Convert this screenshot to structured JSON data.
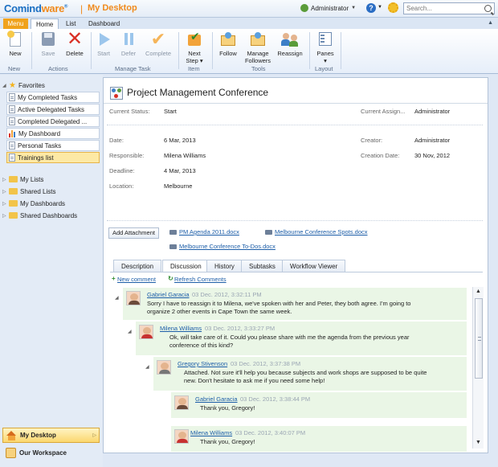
{
  "header": {
    "logo_main": "Comind",
    "logo_accent": "ware",
    "logo_tm": "®",
    "separator": "|",
    "page_title": "My Desktop",
    "user_name": "Administrator",
    "caret": "▼",
    "help_glyph": "?",
    "search_placeholder": "Search..."
  },
  "tabs": {
    "menu": "Menu",
    "home": "Home",
    "list": "List",
    "dashboard": "Dashboard",
    "collapse": "▲"
  },
  "ribbon": {
    "new": "New",
    "save": "Save",
    "delete": "Delete",
    "start": "Start",
    "defer": "Defer",
    "complete": "Complete",
    "next_step_line1": "Next",
    "next_step_line2": "Step ▾",
    "follow": "Follow",
    "manage_followers_line1": "Manage",
    "manage_followers_line2": "Followers",
    "reassign": "Reassign",
    "panes": "Panes",
    "panes_caret": "▾",
    "groups": {
      "new": "New",
      "actions": "Actions",
      "manage_task": "Manage Task",
      "item": "Item",
      "tools": "Tools",
      "layout": "Layout"
    }
  },
  "sidebar": {
    "favorites": "Favorites",
    "items": [
      {
        "label": "My Completed Tasks"
      },
      {
        "label": "Active Delegated Tasks"
      },
      {
        "label": "Completed Delegated ..."
      },
      {
        "label": "My Dashboard"
      },
      {
        "label": "Personal Tasks"
      },
      {
        "label": "Trainings list"
      }
    ],
    "groups": [
      {
        "label": "My Lists"
      },
      {
        "label": "Shared Lists"
      },
      {
        "label": "My Dashboards"
      },
      {
        "label": "Shared Dashboards"
      }
    ],
    "my_desktop": "My Desktop",
    "our_workspace": "Our Workspace"
  },
  "task": {
    "title": "Project Management Conference",
    "fields": {
      "current_status_label": "Current Status:",
      "current_status": "Start",
      "current_assignee_label": "Current Assign...",
      "current_assignee": "Administrator",
      "date_label": "Date:",
      "date": "6 Mar, 2013",
      "creator_label": "Creator:",
      "creator": "Administrator",
      "responsible_label": "Responsible:",
      "responsible": "Milena Williams",
      "creation_date_label": "Creation Date:",
      "creation_date": "30 Nov, 2012",
      "deadline_label": "Deadline:",
      "deadline": "4 Mar, 2013",
      "location_label": "Location:",
      "location": "Melbourne"
    },
    "add_attachment": "Add Attachment",
    "attachments": [
      "PM Agenda 2011.docx",
      "Melbourne Conference Spots.docx",
      "Melbourne Conference To-Dos.docx"
    ]
  },
  "detail_tabs": [
    "Description",
    "Discussion",
    "History",
    "Subtasks",
    "Workflow Viewer"
  ],
  "actions": {
    "new_comment_glyph": "+",
    "new_comment": "New comment",
    "refresh_glyph": "↻",
    "refresh": "Refresh Comments"
  },
  "comments": [
    {
      "author": "Gabriel Garacia",
      "stamp": "03 Dec. 2012, 3:32:11 PM",
      "line1": "Sorry I have to reassign it to Milena, we've spoken with her and Peter, they both agree. I'm going to",
      "line2": "organize 2 other events in Cape Town the same week."
    },
    {
      "author": "Milena Williams",
      "stamp": "03 Dec. 2012, 3:33:27 PM",
      "line1": "Ok, will take care of it. Could you please share with me the agenda from the previous year",
      "line2": "conference of this kind?"
    },
    {
      "author": "Gregory Stivenson",
      "stamp": "03 Dec. 2012, 3:37:38 PM",
      "line1": "Attached. Not sure it'll help you because subjects and work shops are supposed to be quite",
      "line2": "new. Don't hesitate to ask me if you need some help!"
    },
    {
      "author": "Gabriel Garacia",
      "stamp": "03 Dec. 2012, 3:38:44 PM",
      "line1": "Thank you, Gregory!",
      "line2": ""
    },
    {
      "author": "Milena Williams",
      "stamp": "03 Dec. 2012, 3:40:07 PM",
      "line1": "Thank you, Gregory!",
      "line2": ""
    }
  ],
  "glyphs": {
    "tri_down": "◢",
    "tri_right": "▷",
    "star": "★",
    "scroll_up": "▲",
    "scroll_down": "▼",
    "ws_arrow": "▷"
  },
  "colors": {
    "brand_blue": "#1a6fc2",
    "brand_orange": "#f08a1c",
    "comment_bg": "#eaf6e6",
    "link": "#1d5ea8"
  }
}
